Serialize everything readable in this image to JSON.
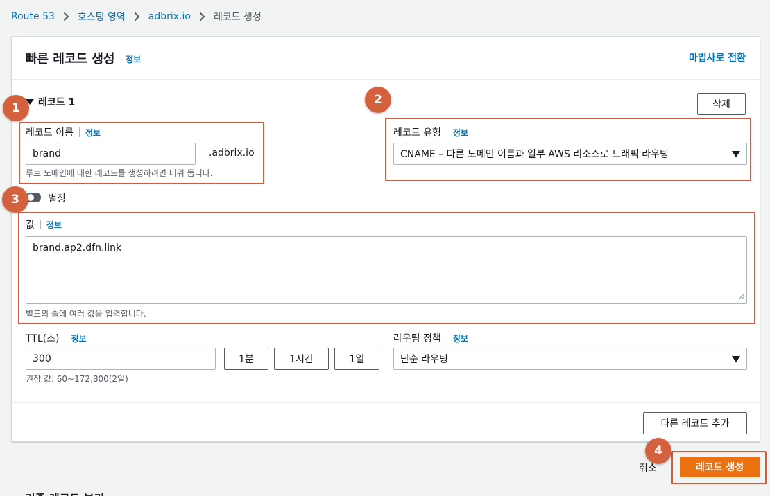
{
  "breadcrumb": {
    "items": [
      "Route 53",
      "호스팅 영역",
      "adbrix.io"
    ],
    "current": "레코드 생성"
  },
  "panel": {
    "title": "빠른 레코드 생성",
    "title_info": "정보",
    "wizard_link": "마법사로 전환"
  },
  "record": {
    "header": "레코드 1",
    "delete_label": "삭제",
    "name_label": "레코드 이름",
    "name_info": "정보",
    "name_value": "brand",
    "domain_suffix": ".adbrix.io",
    "name_hint": "루트 도메인에 대한 레코드를 생성하려면 비워 둡니다.",
    "type_label": "레코드 유형",
    "type_info": "정보",
    "type_value": "CNAME – 다른 도메인 이름과 일부 AWS 리소스로 트래픽 라우팅",
    "alias_label": "별칭",
    "alias_on": false,
    "value_label": "값",
    "value_info": "정보",
    "value_text": "brand.ap2.dfn.link",
    "value_hint": "별도의 줄에 여러 값을 입력합니다.",
    "ttl_label": "TTL(초)",
    "ttl_info": "정보",
    "ttl_value": "300",
    "ttl_buttons": [
      "1분",
      "1시간",
      "1일"
    ],
    "ttl_hint": "권장 값: 60~172,800(2일)",
    "routing_label": "라우팅 정책",
    "routing_info": "정보",
    "routing_value": "단순 라우팅"
  },
  "add_record_label": "다른 레코드 추가",
  "footer": {
    "cancel_label": "취소",
    "create_label": "레코드 생성"
  },
  "next_section_title": "기존 레코드 보기",
  "annotations": [
    "1",
    "2",
    "3",
    "4"
  ],
  "colors": {
    "accent": "#ec7211",
    "link": "#0073bb",
    "annotation": "#d4613e"
  }
}
